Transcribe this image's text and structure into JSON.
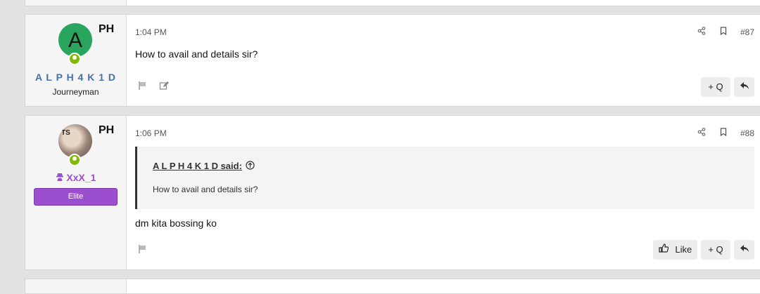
{
  "posts": [
    {
      "avatar_letter": "A",
      "flag_code": "PH",
      "username": "A L P H 4 K 1 D",
      "user_title": "Journeyman",
      "time": "1:04 PM",
      "post_number": "#87",
      "message": "How to avail and details sir?",
      "buttons": {
        "quote": "+ Q"
      }
    },
    {
      "avatar_initials": "TS",
      "flag_code": "PH",
      "username": "XxX_1",
      "user_badge": "Elite",
      "time": "1:06 PM",
      "post_number": "#88",
      "quote": {
        "author": "A L P H 4 K 1 D said:",
        "text": "How to avail and details sir?"
      },
      "message": "dm kita bossing ko",
      "buttons": {
        "like": "Like",
        "quote": "+ Q"
      }
    }
  ],
  "colors": {
    "username1": "#4a6fa5",
    "username2": "#9b4fcf",
    "online": "#7fb900"
  }
}
